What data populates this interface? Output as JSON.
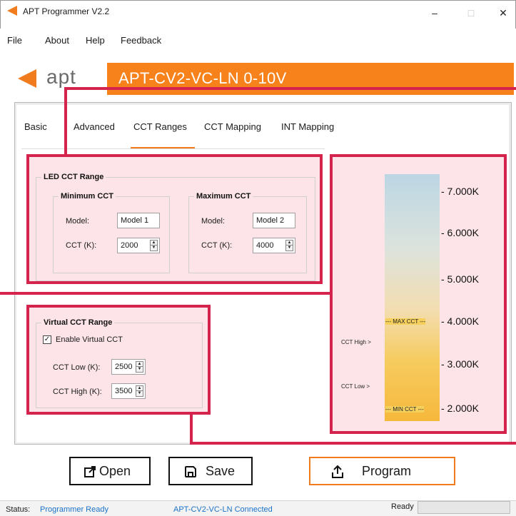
{
  "window": {
    "title": "APT Programmer V2.2",
    "minimize": "–",
    "maximize": "□",
    "close": "✕"
  },
  "menu": [
    "File",
    "About",
    "Help",
    "Feedback"
  ],
  "brand": {
    "logo_text": "apt",
    "model": "APT-CV2-VC-LN 0-10V",
    "accent": "#f7821c"
  },
  "tabs": [
    "Basic",
    "Advanced",
    "CCT Ranges",
    "CCT Mapping",
    "INT Mapping"
  ],
  "active_tab": "CCT Ranges",
  "led_cct": {
    "title": "LED CCT Range",
    "minimum": {
      "title": "Minimum CCT",
      "model_label": "Model:",
      "model_value": "Model 1",
      "cct_label": "CCT (K):",
      "cct_value": "2000"
    },
    "maximum": {
      "title": "Maximum CCT",
      "model_label": "Model:",
      "model_value": "Model 2",
      "cct_label": "CCT (K):",
      "cct_value": "4000"
    }
  },
  "virtual_cct": {
    "title": "Virtual CCT Range",
    "enable_label": "Enable Virtual CCT",
    "enabled": true,
    "low_label": "CCT Low (K):",
    "low_value": "2500",
    "high_label": "CCT High (K):",
    "high_value": "3500"
  },
  "scale": {
    "ticks": [
      "- 7.000K",
      "- 6.000K",
      "- 5.000K",
      "- 4.000K",
      "- 3.000K",
      "- 2.000K"
    ],
    "max_marker": "--- MAX CCT ---",
    "min_marker": "--- MIN CCT ---",
    "cct_high": "CCT High  >",
    "cct_low": "CCT Low  >"
  },
  "buttons": {
    "open": "Open",
    "save": "Save",
    "program": "Program"
  },
  "status": {
    "label": "Status:",
    "state": "Programmer Ready",
    "device": "APT-CV2-VC-LN Connected",
    "ready": "Ready",
    "link_color": "#1b72c8"
  },
  "colors": {
    "highlight": "#d4234d",
    "orange": "#f07c1e"
  }
}
